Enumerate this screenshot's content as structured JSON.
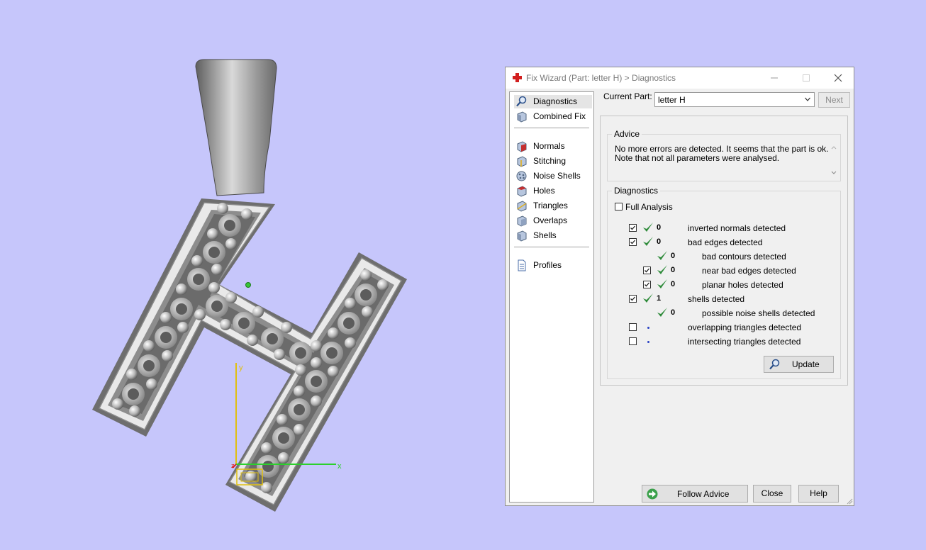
{
  "viewport": {
    "axis_x_label": "x",
    "axis_y_label": "y",
    "axis_z_label": "z",
    "background_color": "#c6c6fb"
  },
  "dialog": {
    "title": "Fix Wizard (Part: letter H) > Diagnostics",
    "nav": {
      "diagnostics": "Diagnostics",
      "combined_fix": "Combined Fix",
      "normals": "Normals",
      "stitching": "Stitching",
      "noise_shells": "Noise Shells",
      "holes": "Holes",
      "triangles": "Triangles",
      "overlaps": "Overlaps",
      "shells": "Shells",
      "profiles": "Profiles"
    },
    "current_part_label": "Current Part:",
    "current_part_value": "letter H",
    "next_label": "Next",
    "advice": {
      "title": "Advice",
      "line1": "No more errors are detected. It seems that the part is ok.",
      "line2": "Note that not all parameters were analysed."
    },
    "diagnostics": {
      "title": "Diagnostics",
      "full_analysis_label": "Full Analysis",
      "rows": {
        "inverted_normals": {
          "count": "0",
          "label": "inverted normals detected"
        },
        "bad_edges": {
          "count": "0",
          "label": "bad edges detected"
        },
        "bad_contours": {
          "count": "0",
          "label": "bad contours detected"
        },
        "near_bad_edges": {
          "count": "0",
          "label": "near bad edges detected"
        },
        "planar_holes": {
          "count": "0",
          "label": "planar holes detected"
        },
        "shells": {
          "count": "1",
          "label": "shells detected"
        },
        "noise_shells": {
          "count": "0",
          "label": "possible noise shells detected"
        },
        "overlapping": {
          "label": "overlapping triangles detected"
        },
        "intersecting": {
          "label": "intersecting triangles detected"
        }
      },
      "update_label": "Update"
    },
    "follow_advice_label": "Follow Advice",
    "close_label": "Close",
    "help_label": "Help",
    "accent_green": "#2e8b3a",
    "accent_red": "#d21f1f"
  }
}
